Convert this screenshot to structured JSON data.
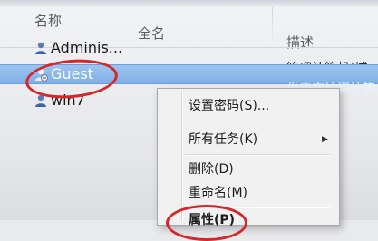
{
  "columns": {
    "name": "名称",
    "fullname": "全名",
    "description": "描述"
  },
  "users": [
    {
      "name": "Adminis...",
      "description": "",
      "icon": "user-icon"
    },
    {
      "name": "Guest",
      "description": "",
      "icon": "user-disabled-icon",
      "selected": true
    },
    {
      "name": "win7",
      "description": "",
      "icon": "user-icon"
    }
  ],
  "user_desc": {
    "admin": "管理计算机(域",
    "guest": "供来宾访问计算"
  },
  "context_menu": {
    "set_password": "设置密码(S)...",
    "all_tasks": "所有任务(K)",
    "delete": "删除(D)",
    "rename": "重命名(M)",
    "properties": "属性(P)"
  },
  "colors": {
    "selection": "#7fb0e7",
    "annotation": "#d5262b"
  }
}
